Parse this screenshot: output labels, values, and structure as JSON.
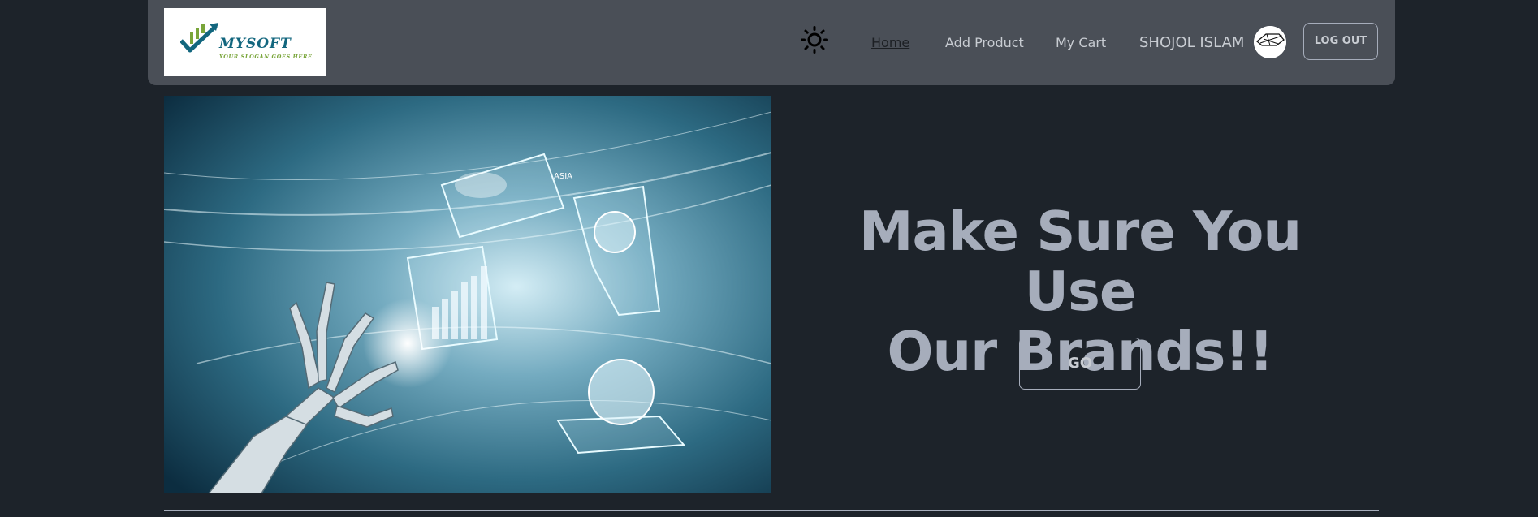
{
  "brand": {
    "name": "MYSOFT",
    "slogan": "YOUR SLOGAN GOES HERE"
  },
  "nav": {
    "items": [
      {
        "label": "Home",
        "active": true
      },
      {
        "label": "Add Product",
        "active": false
      },
      {
        "label": "My Cart",
        "active": false
      }
    ],
    "user_name": "SHOJOL ISLAM",
    "logout_label": "LOG OUT",
    "theme_icon": "sun-icon"
  },
  "hero": {
    "headline_line1": "Make Sure You Use",
    "headline_line2": "Our Brands!!",
    "cta_label": "GO",
    "image_label": "ASIA"
  },
  "colors": {
    "page_bg": "#1d232a",
    "navbar_bg": "#4a4f57",
    "text_muted": "#a6adbb",
    "logo_teal": "#12667e",
    "logo_green": "#79a53a"
  }
}
